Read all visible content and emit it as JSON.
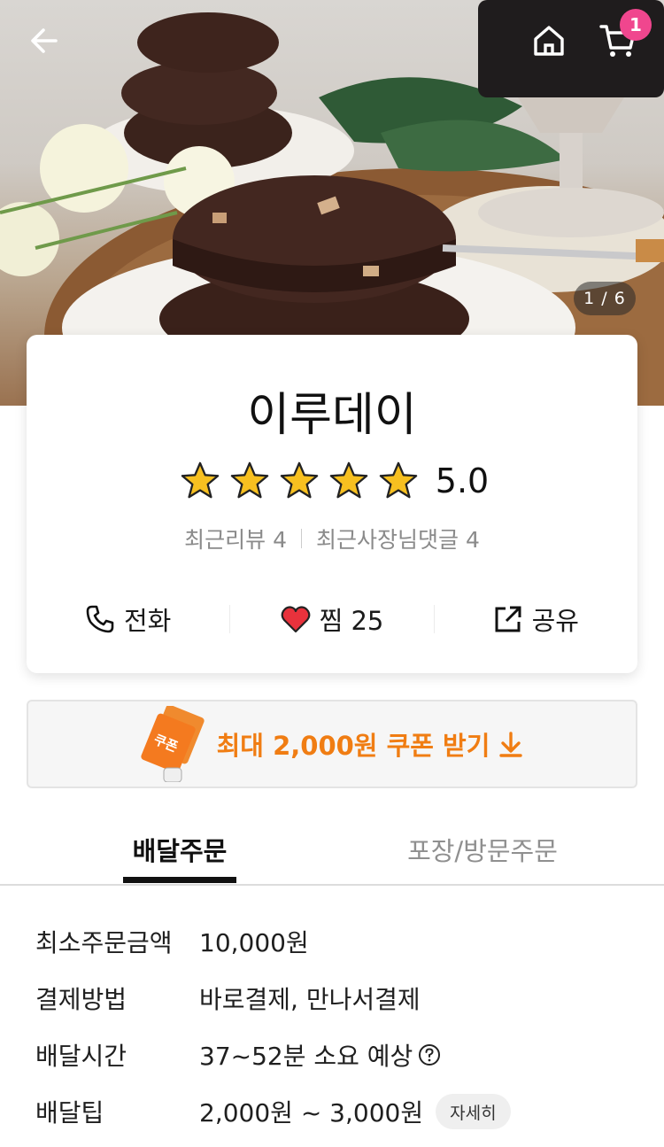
{
  "header": {
    "back_icon": "arrow-left-icon",
    "home_icon": "home-icon",
    "cart_icon": "cart-icon",
    "cart_count": "1",
    "image_counter": "1 / 6"
  },
  "store": {
    "name": "이루데이",
    "rating": "5.0",
    "stars_filled": 5,
    "recent_reviews": "최근리뷰 4",
    "owner_replies": "최근사장님댓글 4",
    "actions": {
      "call": "전화",
      "favorite": "찜 25",
      "share": "공유"
    }
  },
  "coupon": {
    "label": "최대 2,000원 쿠폰 받기",
    "ticket_text": "쿠폰"
  },
  "tabs": {
    "delivery": "배달주문",
    "pickup": "포장/방문주문"
  },
  "info": [
    {
      "label": "최소주문금액",
      "value": "10,000원"
    },
    {
      "label": "결제방법",
      "value": "바로결제, 만나서결제"
    },
    {
      "label": "배달시간",
      "value": "37~52분 소요 예상"
    },
    {
      "label": "배달팁",
      "value": "2,000원 ~ 3,000원",
      "chip": "자세히"
    }
  ],
  "colors": {
    "accent_orange": "#f07d13",
    "badge_pink": "#f0468e",
    "star_yellow": "#f7c020",
    "heart_red": "#e8323c"
  }
}
